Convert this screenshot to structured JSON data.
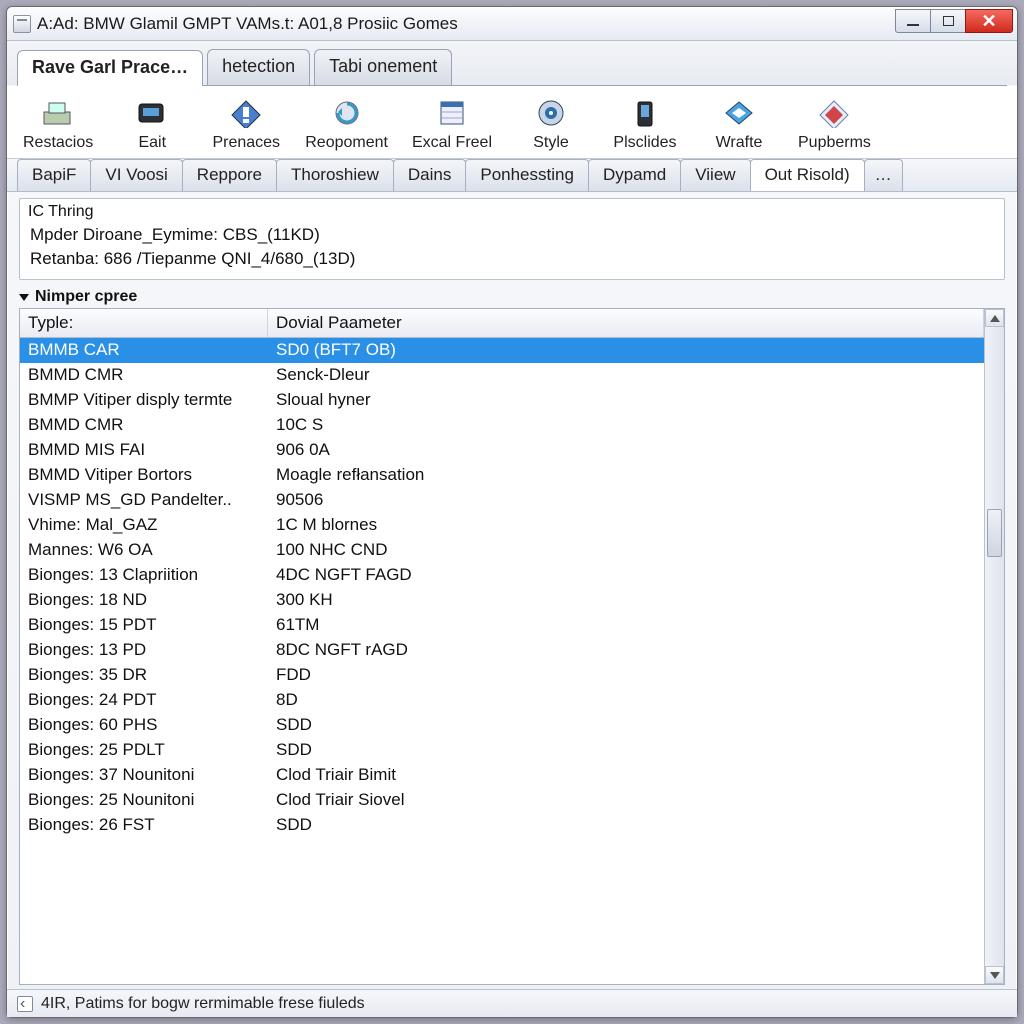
{
  "window": {
    "title": "A:Ad: BMW Glamil GMPT VAMs.t: A01,8 Prosiic Gomes"
  },
  "tabs_main": [
    {
      "label": "Rave Garl Prace…",
      "active": true
    },
    {
      "label": "hetection",
      "active": false
    },
    {
      "label": "Tabi onement",
      "active": false
    }
  ],
  "toolbar": [
    {
      "name": "restacios",
      "label": "Restacios"
    },
    {
      "name": "eait",
      "label": "Eait"
    },
    {
      "name": "prenaces",
      "label": "Prenaces"
    },
    {
      "name": "reopoment",
      "label": "Reopoment"
    },
    {
      "name": "excal-freel",
      "label": "Excal Freel"
    },
    {
      "name": "style",
      "label": "Style"
    },
    {
      "name": "plsclides",
      "label": "Plsclides"
    },
    {
      "name": "wrafte",
      "label": "Wrafte"
    },
    {
      "name": "pupberms",
      "label": "Pupberms"
    }
  ],
  "tabs_secondary": [
    "BapiF",
    "VI Voosi",
    "Reppore",
    "Thoroshiew",
    "Dains",
    "Ponhessting",
    "Dypamd",
    "Viiew",
    "Out Risold)",
    "…"
  ],
  "tabs_secondary_active_index": 8,
  "info": {
    "hdr": "IC Thring",
    "line1": "Mpder Diroane_Eymime: CBS_(11KD)",
    "line2": "Retanba: 686 /Tiepanme QNI_4/680_(13D)"
  },
  "group": {
    "label": "Nimper cpree"
  },
  "table": {
    "columns": [
      "Typle:",
      "Dovial Paameter"
    ],
    "rows": [
      {
        "c0": "BMMB CAR",
        "c1": "SD0 (BFT7 OB)",
        "selected": true
      },
      {
        "c0": "BMMD CMR",
        "c1": "Senck-Dleur"
      },
      {
        "c0": "BMMP Vitiper disply termte",
        "c1": "Sloual hyner"
      },
      {
        "c0": "BMMD CMR",
        "c1": "10C S"
      },
      {
        "c0": "BMMD MIS FAI",
        "c1": "906 0A"
      },
      {
        "c0": "BMMD Vitiper Bortors",
        "c1": "Moagle refłansation"
      },
      {
        "c0": "VISMP MS_GD Pandelter..",
        "c1": "90506"
      },
      {
        "c0": "Vhime: Mal_GAZ",
        "c1": "1C M blornes"
      },
      {
        "c0": "Mannes: W6 OA",
        "c1": "100 NHC CND"
      },
      {
        "c0": "Bionges: 13 Clapriition",
        "c1": "4DC NGFT FAGD"
      },
      {
        "c0": "Bionges: 18 ND",
        "c1": "300 KH"
      },
      {
        "c0": "Bionges: 15 PDT",
        "c1": "61TM"
      },
      {
        "c0": "Bionges: 13 PD",
        "c1": "8DC NGFT rAGD"
      },
      {
        "c0": "Bionges: 35 DR",
        "c1": "FDD"
      },
      {
        "c0": "Bionges: 24 PDT",
        "c1": "8D"
      },
      {
        "c0": "Bionges: 60 PHS",
        "c1": "SDD"
      },
      {
        "c0": "Bionges: 25 PDLT",
        "c1": "SDD"
      },
      {
        "c0": "Bionges: 37 Nounitoni",
        "c1": "Clod Triair Bimit"
      },
      {
        "c0": "Bionges: 25 Nounitoni",
        "c1": "Clod Triair Siovel"
      },
      {
        "c0": "Bionges: 26 FST",
        "c1": "SDD"
      }
    ]
  },
  "status": "4IR, Patims for bogw rermimable frese fiuleds"
}
